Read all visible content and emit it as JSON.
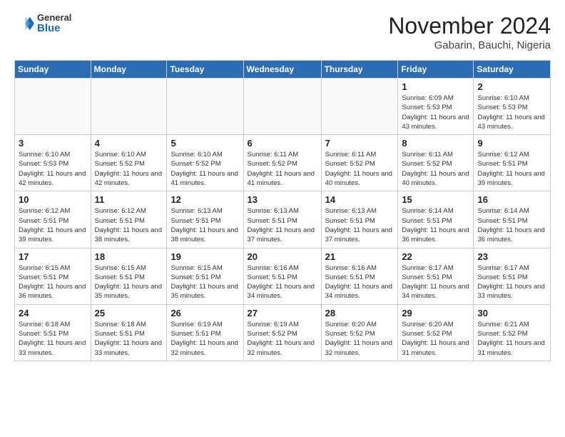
{
  "header": {
    "logo_general": "General",
    "logo_blue": "Blue",
    "month_title": "November 2024",
    "location": "Gabarin, Bauchi, Nigeria"
  },
  "days_of_week": [
    "Sunday",
    "Monday",
    "Tuesday",
    "Wednesday",
    "Thursday",
    "Friday",
    "Saturday"
  ],
  "weeks": [
    [
      {
        "day": "",
        "info": ""
      },
      {
        "day": "",
        "info": ""
      },
      {
        "day": "",
        "info": ""
      },
      {
        "day": "",
        "info": ""
      },
      {
        "day": "",
        "info": ""
      },
      {
        "day": "1",
        "info": "Sunrise: 6:09 AM\nSunset: 5:53 PM\nDaylight: 11 hours and 43 minutes."
      },
      {
        "day": "2",
        "info": "Sunrise: 6:10 AM\nSunset: 5:53 PM\nDaylight: 11 hours and 43 minutes."
      }
    ],
    [
      {
        "day": "3",
        "info": "Sunrise: 6:10 AM\nSunset: 5:53 PM\nDaylight: 11 hours and 42 minutes."
      },
      {
        "day": "4",
        "info": "Sunrise: 6:10 AM\nSunset: 5:52 PM\nDaylight: 11 hours and 42 minutes."
      },
      {
        "day": "5",
        "info": "Sunrise: 6:10 AM\nSunset: 5:52 PM\nDaylight: 11 hours and 41 minutes."
      },
      {
        "day": "6",
        "info": "Sunrise: 6:11 AM\nSunset: 5:52 PM\nDaylight: 11 hours and 41 minutes."
      },
      {
        "day": "7",
        "info": "Sunrise: 6:11 AM\nSunset: 5:52 PM\nDaylight: 11 hours and 40 minutes."
      },
      {
        "day": "8",
        "info": "Sunrise: 6:11 AM\nSunset: 5:52 PM\nDaylight: 11 hours and 40 minutes."
      },
      {
        "day": "9",
        "info": "Sunrise: 6:12 AM\nSunset: 5:51 PM\nDaylight: 11 hours and 39 minutes."
      }
    ],
    [
      {
        "day": "10",
        "info": "Sunrise: 6:12 AM\nSunset: 5:51 PM\nDaylight: 11 hours and 39 minutes."
      },
      {
        "day": "11",
        "info": "Sunrise: 6:12 AM\nSunset: 5:51 PM\nDaylight: 11 hours and 38 minutes."
      },
      {
        "day": "12",
        "info": "Sunrise: 6:13 AM\nSunset: 5:51 PM\nDaylight: 11 hours and 38 minutes."
      },
      {
        "day": "13",
        "info": "Sunrise: 6:13 AM\nSunset: 5:51 PM\nDaylight: 11 hours and 37 minutes."
      },
      {
        "day": "14",
        "info": "Sunrise: 6:13 AM\nSunset: 5:51 PM\nDaylight: 11 hours and 37 minutes."
      },
      {
        "day": "15",
        "info": "Sunrise: 6:14 AM\nSunset: 5:51 PM\nDaylight: 11 hours and 36 minutes."
      },
      {
        "day": "16",
        "info": "Sunrise: 6:14 AM\nSunset: 5:51 PM\nDaylight: 11 hours and 36 minutes."
      }
    ],
    [
      {
        "day": "17",
        "info": "Sunrise: 6:15 AM\nSunset: 5:51 PM\nDaylight: 11 hours and 36 minutes."
      },
      {
        "day": "18",
        "info": "Sunrise: 6:15 AM\nSunset: 5:51 PM\nDaylight: 11 hours and 35 minutes."
      },
      {
        "day": "19",
        "info": "Sunrise: 6:15 AM\nSunset: 5:51 PM\nDaylight: 11 hours and 35 minutes."
      },
      {
        "day": "20",
        "info": "Sunrise: 6:16 AM\nSunset: 5:51 PM\nDaylight: 11 hours and 34 minutes."
      },
      {
        "day": "21",
        "info": "Sunrise: 6:16 AM\nSunset: 5:51 PM\nDaylight: 11 hours and 34 minutes."
      },
      {
        "day": "22",
        "info": "Sunrise: 6:17 AM\nSunset: 5:51 PM\nDaylight: 11 hours and 34 minutes."
      },
      {
        "day": "23",
        "info": "Sunrise: 6:17 AM\nSunset: 5:51 PM\nDaylight: 11 hours and 33 minutes."
      }
    ],
    [
      {
        "day": "24",
        "info": "Sunrise: 6:18 AM\nSunset: 5:51 PM\nDaylight: 11 hours and 33 minutes."
      },
      {
        "day": "25",
        "info": "Sunrise: 6:18 AM\nSunset: 5:51 PM\nDaylight: 11 hours and 33 minutes."
      },
      {
        "day": "26",
        "info": "Sunrise: 6:19 AM\nSunset: 5:51 PM\nDaylight: 11 hours and 32 minutes."
      },
      {
        "day": "27",
        "info": "Sunrise: 6:19 AM\nSunset: 5:52 PM\nDaylight: 11 hours and 32 minutes."
      },
      {
        "day": "28",
        "info": "Sunrise: 6:20 AM\nSunset: 5:52 PM\nDaylight: 11 hours and 32 minutes."
      },
      {
        "day": "29",
        "info": "Sunrise: 6:20 AM\nSunset: 5:52 PM\nDaylight: 11 hours and 31 minutes."
      },
      {
        "day": "30",
        "info": "Sunrise: 6:21 AM\nSunset: 5:52 PM\nDaylight: 11 hours and 31 minutes."
      }
    ]
  ]
}
